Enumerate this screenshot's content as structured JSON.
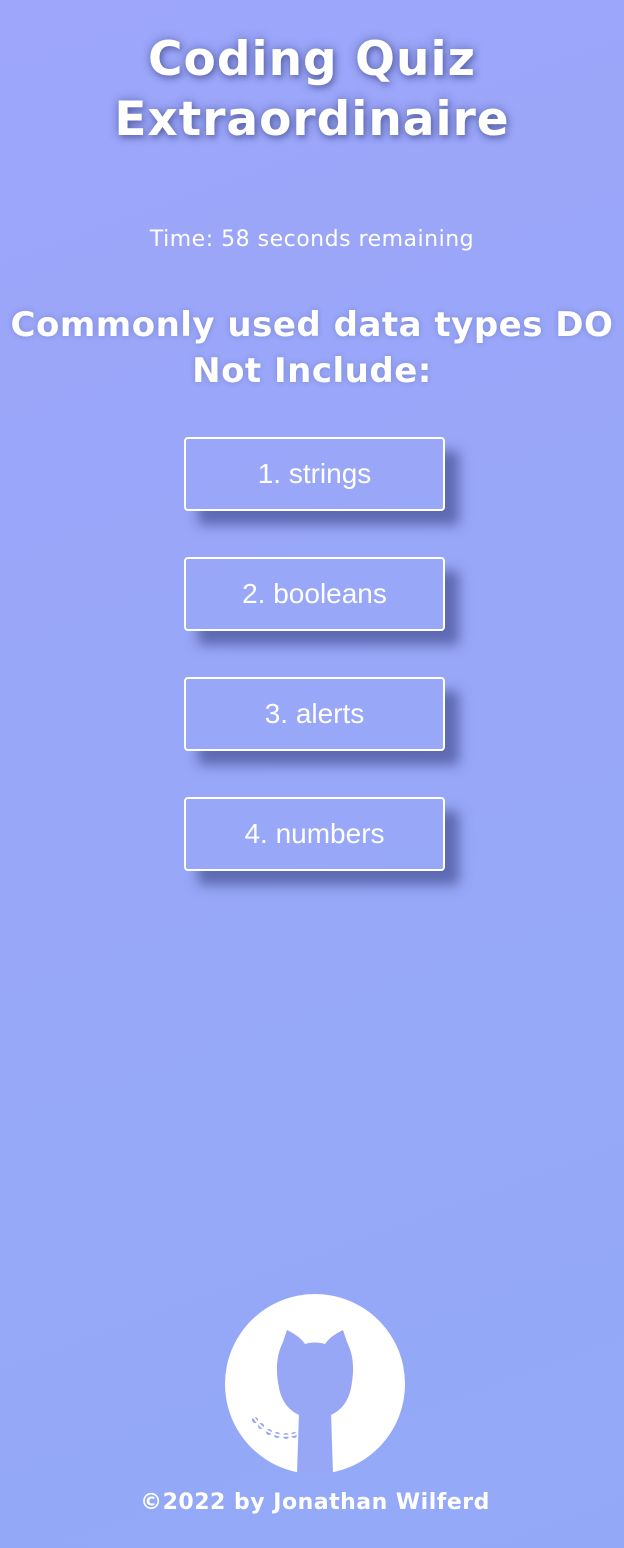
{
  "header": {
    "title_line1": "Coding Quiz",
    "title_line2": "Extraordinaire"
  },
  "timer": {
    "text": "Time: 58 seconds remaining"
  },
  "quiz": {
    "question": "Commonly used data types DO Not Include:",
    "answers": [
      {
        "label": "1. strings"
      },
      {
        "label": "2. booleans"
      },
      {
        "label": "3. alerts"
      },
      {
        "label": "4. numbers"
      }
    ]
  },
  "footer": {
    "copyright": "©2022 by Jonathan Wilferd",
    "icon": "github-icon"
  },
  "colors": {
    "background": "#99a8f9",
    "text": "#ffffff"
  }
}
